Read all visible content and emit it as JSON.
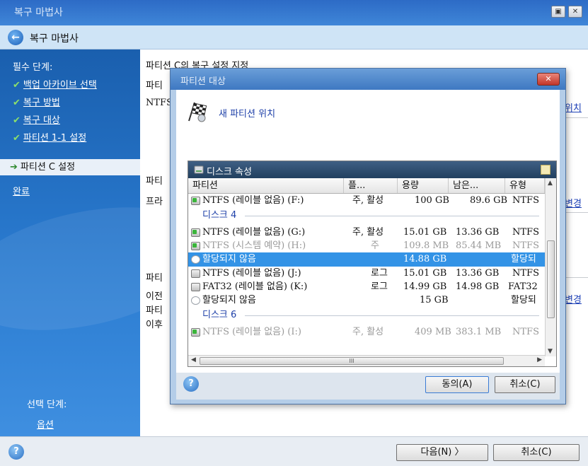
{
  "window": {
    "title": "복구 마법사"
  },
  "header": {
    "title": "복구 마법사"
  },
  "sidebar": {
    "required_label": "필수 단계:",
    "items": [
      {
        "label": "백업 아카이브 선택",
        "done": true
      },
      {
        "label": "복구 방법",
        "done": true
      },
      {
        "label": "복구 대상",
        "done": true
      },
      {
        "label": "파티션 1-1 설정",
        "done": true
      },
      {
        "label": "파티션 C 설정",
        "active": true
      },
      {
        "label": "완료"
      }
    ],
    "optional_label": "선택 단계:",
    "optional_items": [
      {
        "label": "옵션"
      }
    ]
  },
  "main": {
    "line1": "파티션 C의 복구 설정 지정",
    "line2": "파티",
    "line3": "NTFS",
    "line4": "파티",
    "line5": "프라",
    "line6": "파티",
    "line7": "이전",
    "line8": "파티",
    "line9": "이후",
    "link_location": "위치",
    "link_change1": "변경",
    "link_change2": "변경"
  },
  "dialog": {
    "title": "파티션 대상",
    "close_label": "✕",
    "heading": "새 파티션 위치",
    "panel_title": "디스크 속성",
    "columns": [
      "파티션",
      "플...",
      "용량",
      "남은...",
      "유형"
    ],
    "rows": [
      {
        "kind": "part",
        "icon": "green",
        "name": "NTFS (레이블 없음) (F:)",
        "flag": "주, 활성",
        "size": "100 GB",
        "free": "89.6 GB",
        "type": "NTFS"
      },
      {
        "kind": "group",
        "label": "디스크 4"
      },
      {
        "kind": "part",
        "icon": "green",
        "name": "NTFS (레이블 없음) (G:)",
        "flag": "주, 활성",
        "size": "15.01 GB",
        "free": "13.36 GB",
        "type": "NTFS"
      },
      {
        "kind": "part",
        "icon": "green",
        "dim": true,
        "name": "NTFS (시스템 예약) (H:)",
        "flag": "주",
        "size": "109.8 MB",
        "free": "85.44 MB",
        "type": "NTFS"
      },
      {
        "kind": "part",
        "icon": "empty",
        "selected": true,
        "name": "할당되지 않음",
        "flag": "",
        "size": "14.88 GB",
        "free": "",
        "type": "할당되"
      },
      {
        "kind": "part",
        "icon": "plain",
        "name": "NTFS (레이블 없음) (J:)",
        "flag": "로그",
        "size": "15.01 GB",
        "free": "13.36 GB",
        "type": "NTFS"
      },
      {
        "kind": "part",
        "icon": "plain",
        "name": "FAT32 (레이블 없음) (K:)",
        "flag": "로그",
        "size": "14.99 GB",
        "free": "14.98 GB",
        "type": "FAT32"
      },
      {
        "kind": "part",
        "icon": "empty",
        "name": "할당되지 않음",
        "flag": "",
        "size": "15 GB",
        "free": "",
        "type": "할당되"
      },
      {
        "kind": "group",
        "label": "디스크 6"
      },
      {
        "kind": "part",
        "icon": "green",
        "dim": true,
        "name": "NTFS (레이블 없음) (I:)",
        "flag": "주, 활성",
        "size": "409 MB",
        "free": "383.1 MB",
        "type": "NTFS"
      }
    ],
    "hscroll_grip": "III",
    "ok_label": "동의(A)",
    "cancel_label": "취소(C)"
  },
  "footer": {
    "next_label": "다음(N) 〉",
    "cancel_label": "취소(C)"
  }
}
